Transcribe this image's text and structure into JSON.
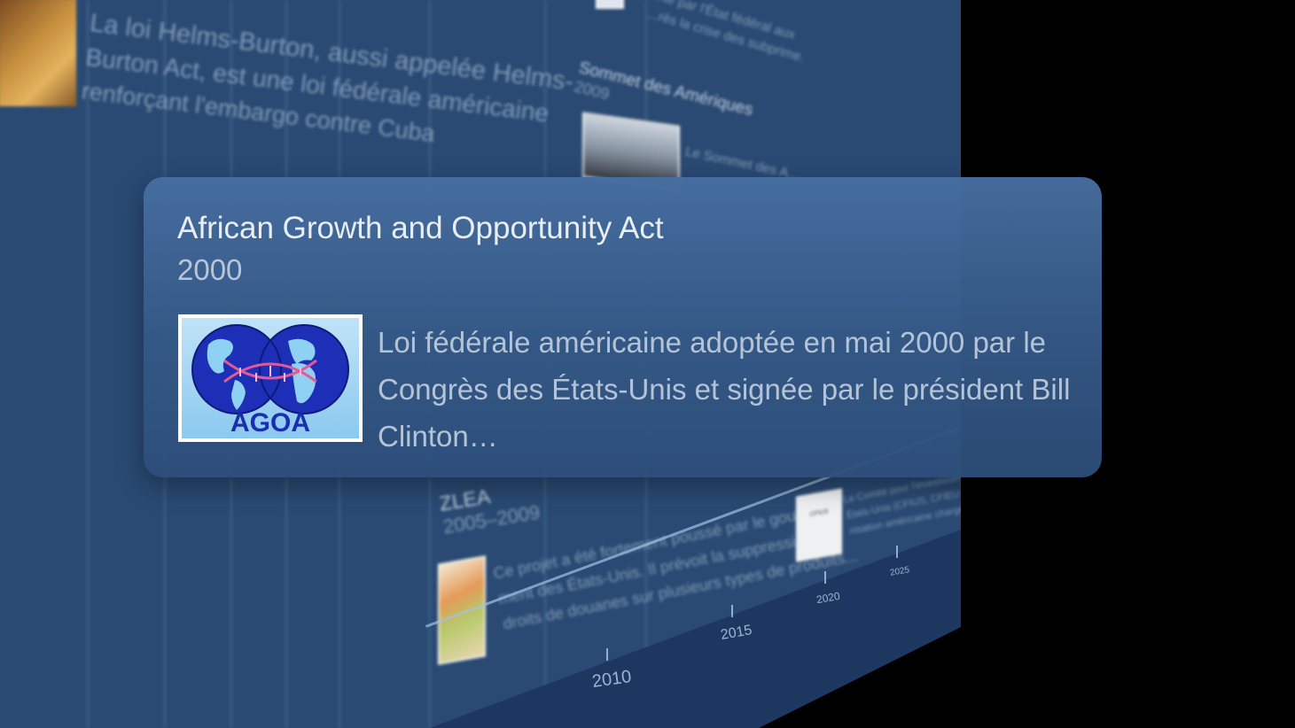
{
  "background": {
    "item_top": {
      "text_lines": [
        "La loi Helms-Burton, aussi appelée Helms-",
        "Burton Act, est une loi fédérale américaine",
        "renforçant l'embargo contre Cuba"
      ]
    },
    "item_top_right": {
      "text_lines": [
        "...te par l'État fédéral aux",
        "...rès la crise des subprime."
      ]
    },
    "item_sommet": {
      "title": "Sommet des Amériques",
      "year": "2009",
      "snippet": "Le Sommet des A..."
    },
    "item_zlea": {
      "title": "ZLEA",
      "years": "2005–2009",
      "text_lines": [
        "Ce projet a été fortement poussé par le gouverne-",
        "ment des États-Unis. Il prévoit la suppression des",
        "droits de douanes sur plusieurs types de produits..."
      ]
    },
    "item_cfius": {
      "text_lines": [
        "Le Comité pour l'investissement étranger aux",
        "États-Unis (CFIUS, CFIEU en FR) est une orga-",
        "nisation américaine chargée d'analyser le..."
      ],
      "thumb_label": "CFIUS"
    },
    "axis_ticks": [
      "2010",
      "2015",
      "2020",
      "2025"
    ]
  },
  "card": {
    "title": "African Growth and Opportunity Act",
    "year": "2000",
    "description": "Loi fédérale américaine adoptée en mai 2000 par le Congrès des États-Unis et signée par le président Bill Clinton…",
    "logo": {
      "icon": "agoa-globe-logo",
      "text": "AGOA"
    }
  },
  "colors": {
    "panel": "#2a4a73",
    "card": "#466ea0",
    "logo_blue": "#1a2fb0"
  }
}
